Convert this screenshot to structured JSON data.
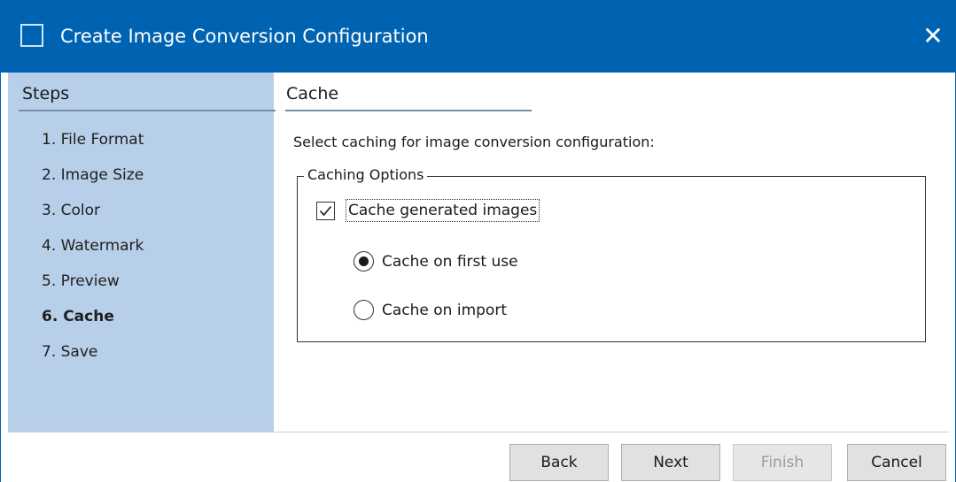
{
  "window": {
    "title": "Create Image Conversion Configuration",
    "close_glyph": "✕",
    "title_bar_color": "#0063b1",
    "sidebar_color": "#b7cfe9"
  },
  "sidebar": {
    "header": "Steps",
    "steps": [
      {
        "label": "1. File Format",
        "active": false
      },
      {
        "label": "2. Image Size",
        "active": false
      },
      {
        "label": "3. Color",
        "active": false
      },
      {
        "label": "4. Watermark",
        "active": false
      },
      {
        "label": "5. Preview",
        "active": false
      },
      {
        "label": "6. Cache",
        "active": true
      },
      {
        "label": "7. Save",
        "active": false
      }
    ]
  },
  "content": {
    "header": "Cache",
    "instruction": "Select caching for image conversion configuration:",
    "group": {
      "legend": "Caching Options",
      "checkbox": {
        "label": "Cache generated images",
        "checked": true
      },
      "radios": [
        {
          "label": "Cache on first use",
          "selected": true
        },
        {
          "label": "Cache on import",
          "selected": false
        }
      ]
    }
  },
  "footer": {
    "back": "Back",
    "next": "Next",
    "finish": "Finish",
    "finish_enabled": false,
    "cancel": "Cancel"
  }
}
